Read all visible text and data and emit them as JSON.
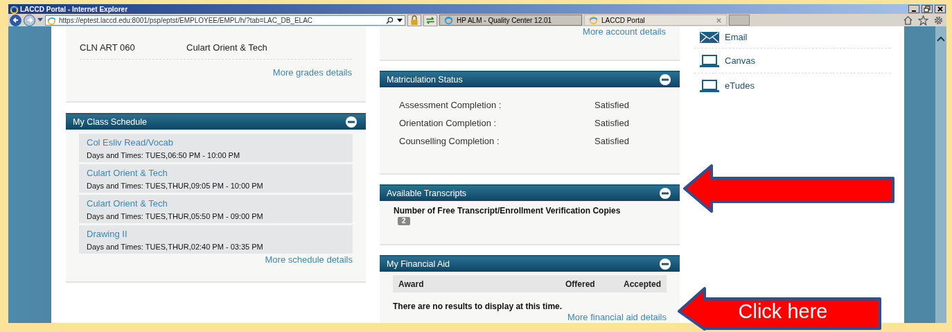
{
  "browser": {
    "title": "LACCD Portal - Internet Explorer",
    "url": "https://eptest.laccd.edu:8001/psp/eptst/EMPLOYEE/EMPL/h/?tab=LAC_DB_ELAC",
    "tabs": [
      {
        "label": "HP ALM - Quality Center 12.01",
        "selected": false
      },
      {
        "label": "LACCD Portal",
        "selected": true
      }
    ]
  },
  "grades": {
    "rows": [
      {
        "course": "CLN ART 060",
        "title": "Culart Orient & Tech"
      }
    ],
    "link": "More grades details"
  },
  "schedule": {
    "title": "My Class Schedule",
    "classes": [
      {
        "name": "Col Esliv Read/Vocab",
        "times": "Days and Times: TUES,06:50 PM - 10:00 PM"
      },
      {
        "name": "Culart Orient & Tech",
        "times": "Days and Times: TUES,THUR,09:05 PM - 10:00 PM"
      },
      {
        "name": "Culart Orient & Tech",
        "times": "Days and Times: TUES,THUR,05:50 PM - 09:00 PM"
      },
      {
        "name": "Drawing II",
        "times": "Days and Times: TUES,THUR,02:40 PM - 03:35 PM"
      }
    ],
    "link": "More schedule details"
  },
  "account": {
    "link": "More account details"
  },
  "matriculation": {
    "title": "Matriculation Status",
    "rows": [
      {
        "label": "Assessment Completion :",
        "value": "Satisfied"
      },
      {
        "label": "Orientation Completion :",
        "value": "Satisfied"
      },
      {
        "label": "Counselling Completion :",
        "value": "Satisfied"
      }
    ]
  },
  "transcripts": {
    "title": "Available Transcripts",
    "text": "Number of Free Transcript/Enrollment Verification Copies",
    "count": "2"
  },
  "financial_aid": {
    "title": "My Financial Aid",
    "columns": [
      "Award",
      "Offered",
      "Accepted"
    ],
    "message": "There are no results to display at this time.",
    "link": "More financial aid details"
  },
  "links": [
    {
      "label": "Email",
      "kind": "mail"
    },
    {
      "label": "Canvas",
      "kind": "laptop"
    },
    {
      "label": "eTudes",
      "kind": "laptop"
    }
  ],
  "callouts": [
    {
      "kind": "arrow"
    },
    {
      "kind": "arrow",
      "label": "Click here"
    }
  ]
}
